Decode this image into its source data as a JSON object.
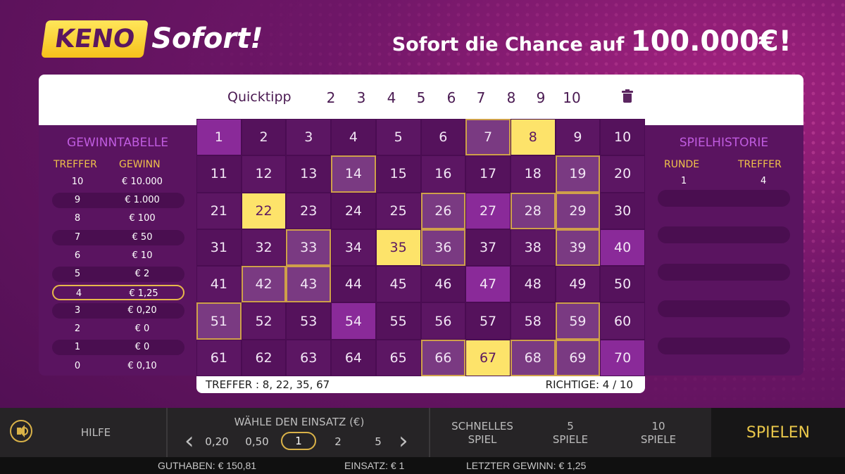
{
  "header": {
    "logo_keno": "KENO",
    "logo_sofort": "Sofort!",
    "tagline_prefix": "Sofort die Chance auf ",
    "tagline_amount": "100.000€!"
  },
  "quicktipp": {
    "label": "Quicktipp",
    "options": [
      "2",
      "3",
      "4",
      "5",
      "6",
      "7",
      "8",
      "9",
      "10"
    ],
    "clear_icon": "trash-icon"
  },
  "gewinntabelle": {
    "title": "GEWINNTABELLE",
    "col_treffer": "TREFFER",
    "col_gewinn": "GEWINN",
    "rows": [
      {
        "treffer": "10",
        "gewinn": "€ 10.000"
      },
      {
        "treffer": "9",
        "gewinn": "€ 1.000"
      },
      {
        "treffer": "8",
        "gewinn": "€ 100"
      },
      {
        "treffer": "7",
        "gewinn": "€ 50"
      },
      {
        "treffer": "6",
        "gewinn": "€ 10"
      },
      {
        "treffer": "5",
        "gewinn": "€ 2"
      },
      {
        "treffer": "4",
        "gewinn": "€ 1,25"
      },
      {
        "treffer": "3",
        "gewinn": "€ 0,20"
      },
      {
        "treffer": "2",
        "gewinn": "€ 0"
      },
      {
        "treffer": "1",
        "gewinn": "€ 0"
      },
      {
        "treffer": "0",
        "gewinn": "€ 0,10"
      }
    ],
    "active_row": 6
  },
  "spielhistorie": {
    "title": "SPIELHISTORIE",
    "col_runde": "RUNDE",
    "col_treffer": "TREFFER",
    "rows": [
      {
        "runde": "1",
        "treffer": "4"
      }
    ]
  },
  "grid": {
    "picked": [
      7,
      14,
      19,
      26,
      28,
      29,
      33,
      36,
      39,
      42,
      43,
      51,
      59,
      66,
      68,
      69
    ],
    "hits": [
      8,
      22,
      35,
      67
    ],
    "drawn_only": [
      1,
      27,
      40,
      47,
      54,
      70
    ]
  },
  "result": {
    "treffer_text": "TREFFER : 8,  22,  35,  67",
    "richtige_text": "RICHTIGE: 4 / 10"
  },
  "controls": {
    "hilfe": "HILFE",
    "einsatz_label": "WÄHLE DEN EINSATZ (€)",
    "stakes": [
      "0,20",
      "0,50",
      "1",
      "2",
      "5"
    ],
    "selected_stake": "1",
    "schnelles_line1": "SCHNELLES",
    "schnelles_line2": "SPIEL",
    "five_line1": "5",
    "five_line2": "SPIELE",
    "ten_line1": "10",
    "ten_line2": "SPIELE",
    "spielen": "SPIELEN"
  },
  "status": {
    "guthaben": "GUTHABEN: € 150,81",
    "einsatz": "EINSATZ: € 1",
    "letzter_gewinn": "LETZTER GEWINN: € 1,25"
  },
  "colors": {
    "accent_gold": "#f6c21b",
    "hit_yellow": "#fde36a",
    "background_purple": "#6e1667"
  }
}
